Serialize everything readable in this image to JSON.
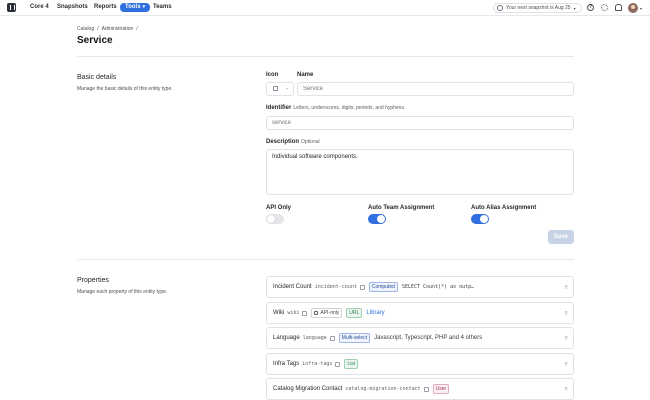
{
  "nav": {
    "items": [
      "Core 4",
      "Snapshots",
      "Reports",
      "Tools",
      "Teams"
    ],
    "snapshot_text": "Your next snapshot is Aug 25"
  },
  "breadcrumb": [
    "Catalog",
    "/",
    "Administration",
    "/"
  ],
  "page_title": "Service",
  "basic": {
    "title": "Basic details",
    "desc": "Manage the basic details of this entity type.",
    "icon_label": "Icon",
    "name_label": "Name",
    "name_placeholder": "Service",
    "identifier_label": "Identifier",
    "identifier_hint": "Letters, underscores, digits, periods, and hyphens.",
    "identifier_placeholder": "service",
    "description_label": "Description",
    "description_hint": "Optional",
    "description_value": "Individual software components.",
    "api_only_label": "API Only",
    "auto_team_label": "Auto Team Assignment",
    "auto_alias_label": "Auto Alias Assignment",
    "save_label": "Save"
  },
  "toggles": {
    "api_only": false,
    "auto_team": true,
    "auto_alias": true
  },
  "properties": {
    "title": "Properties",
    "desc": "Manage each property of this entity type.",
    "items": [
      {
        "name": "Incident Count",
        "id": "incident-count",
        "tags": [
          {
            "text": "Computed",
            "style": "blue"
          }
        ],
        "value": "SELECT Count(*) as outp…",
        "value_style": "mono"
      },
      {
        "name": "Wiki",
        "id": "wiki",
        "tags": [
          {
            "text": "API-only",
            "style": "plain"
          },
          {
            "text": "URL",
            "style": "green"
          }
        ],
        "value": "Library",
        "value_style": "link"
      },
      {
        "name": "Language",
        "id": "language",
        "tags": [
          {
            "text": "Multi-select",
            "style": "blue"
          }
        ],
        "value": "Javascript, Typescript, PHP and 4 others",
        "value_style": ""
      },
      {
        "name": "Infra Tags",
        "id": "infra-tags",
        "tags": [
          {
            "text": "List",
            "style": "green"
          }
        ],
        "value": "",
        "value_style": ""
      },
      {
        "name": "Catalog Migration Contact",
        "id": "catalog-migration-contact",
        "tags": [
          {
            "text": "User",
            "style": "pink"
          }
        ],
        "value": "",
        "value_style": ""
      }
    ]
  },
  "colors": {
    "accent": "#2f6fe0",
    "save_disabled": "#c8d3e6"
  }
}
